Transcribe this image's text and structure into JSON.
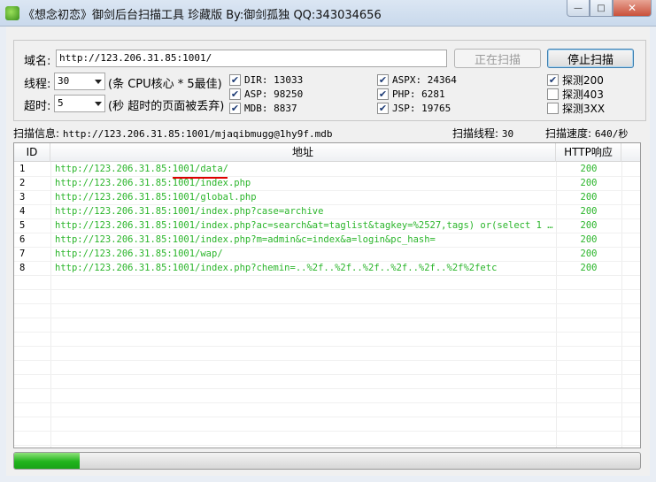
{
  "window": {
    "title": "《想念初恋》御剑后台扫描工具 珍藏版 By:御剑孤独 QQ:343034656",
    "min_label": "—",
    "max_label": "□",
    "close_label": "✕"
  },
  "form": {
    "domain_label": "域名:",
    "domain_value": "http://123.206.31.85:1001/",
    "threads_label": "线程:",
    "threads_value": "30",
    "threads_hint": "(条 CPU核心 * 5最佳)",
    "timeout_label": "超时:",
    "timeout_value": "5",
    "timeout_hint": "(秒 超时的页面被丢弃)",
    "scan_button": "正在扫描",
    "stop_button": "停止扫描"
  },
  "dicts": [
    {
      "label": "DIR: 13033",
      "checked": true
    },
    {
      "label": "ASP: 98250",
      "checked": true
    },
    {
      "label": "MDB: 8837",
      "checked": true
    },
    {
      "label": "ASPX: 24364",
      "checked": true
    },
    {
      "label": "PHP: 6281",
      "checked": true
    },
    {
      "label": "JSP: 19765",
      "checked": true
    }
  ],
  "probes": [
    {
      "label": "探测200",
      "checked": true
    },
    {
      "label": "探测403",
      "checked": false
    },
    {
      "label": "探测3XX",
      "checked": false
    }
  ],
  "status": {
    "info_label": "扫描信息:",
    "info_value": "http://123.206.31.85:1001/mjaqibmugg@1hy9f.mdb",
    "threads_label": "扫描线程:",
    "threads_value": "30",
    "speed_label": "扫描速度:",
    "speed_value": "640/秒"
  },
  "table": {
    "headers": {
      "id": "ID",
      "url": "地址",
      "code": "HTTP响应"
    },
    "rows": [
      {
        "id": "1",
        "url": "http://123.206.31.85:1001/data/",
        "code": "200"
      },
      {
        "id": "2",
        "url": "http://123.206.31.85:1001/index.php",
        "code": "200"
      },
      {
        "id": "3",
        "url": "http://123.206.31.85:1001/global.php",
        "code": "200"
      },
      {
        "id": "4",
        "url": "http://123.206.31.85:1001/index.php?case=archive",
        "code": "200"
      },
      {
        "id": "5",
        "url": "http://123.206.31.85:1001/index.php?ac=search&at=taglist&tagkey=%2527,tags) or(select 1 fr...",
        "code": "200"
      },
      {
        "id": "6",
        "url": "http://123.206.31.85:1001/index.php?m=admin&c=index&a=login&pc_hash=",
        "code": "200"
      },
      {
        "id": "7",
        "url": "http://123.206.31.85:1001/wap/",
        "code": "200"
      },
      {
        "id": "8",
        "url": "http://123.206.31.85:1001/index.php?chemin=..%2f..%2f..%2f..%2f..%2f..%2f%2fetc",
        "code": "200"
      }
    ]
  },
  "progress": {
    "fraction": 0.105
  },
  "colors": {
    "ok_text": "#2ab52a",
    "progress_fill": "#21b41c",
    "annotation_line": "#e00000"
  }
}
